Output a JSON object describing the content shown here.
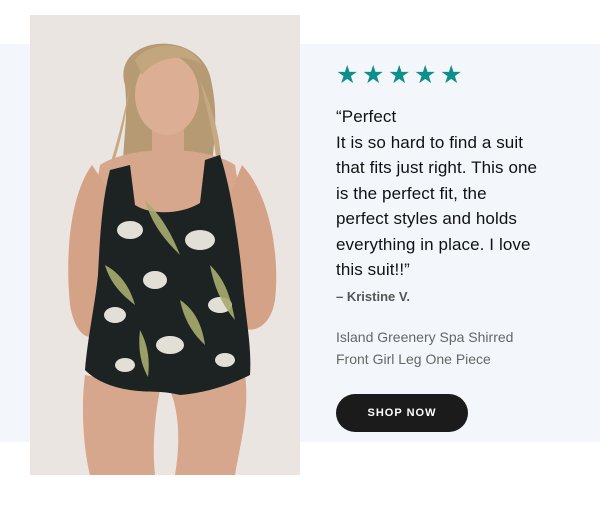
{
  "rating": {
    "stars": 5,
    "star_glyph": "★",
    "color": "#0f8f8c"
  },
  "review": {
    "quote_lines": [
      "“Perfect",
      "It is so hard to find a suit",
      "that fits just right. This one",
      "is the perfect fit, the",
      "perfect styles and holds",
      "everything in place. I love",
      "this suit!!”"
    ],
    "author": "– Kristine V."
  },
  "product": {
    "name_lines": [
      "Island Greenery Spa Shirred",
      "Front Girl Leg One Piece"
    ]
  },
  "cta": {
    "label": "SHOP NOW",
    "background": "#1b1b1b",
    "text_color": "#ffffff"
  },
  "colors": {
    "band_background": "#f3f7fb",
    "photo_background": "#ebe5e1"
  }
}
